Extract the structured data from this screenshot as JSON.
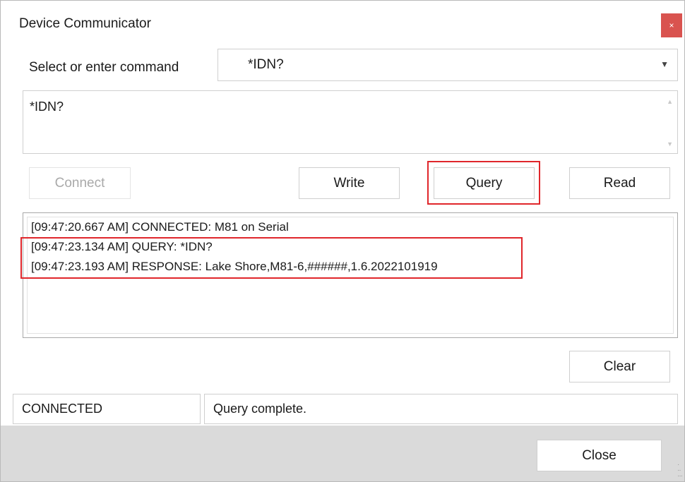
{
  "window": {
    "title": "Device Communicator",
    "close_glyph": "×"
  },
  "command": {
    "label": "Select or enter command",
    "selected": "*IDN?",
    "text": "*IDN?"
  },
  "buttons": {
    "connect": "Connect",
    "write": "Write",
    "query": "Query",
    "read": "Read",
    "clear": "Clear",
    "close": "Close"
  },
  "log": {
    "lines": [
      "[09:47:20.667 AM] CONNECTED: M81 on Serial",
      "[09:47:23.134 AM] QUERY: *IDN?",
      "[09:47:23.193 AM] RESPONSE: Lake Shore,M81-6,######,1.6.2022101919"
    ]
  },
  "status": {
    "connection": "CONNECTED",
    "message": "Query complete."
  },
  "colors": {
    "highlight": "#e0262b",
    "close_button": "#d9534f",
    "footer": "#dadada"
  }
}
